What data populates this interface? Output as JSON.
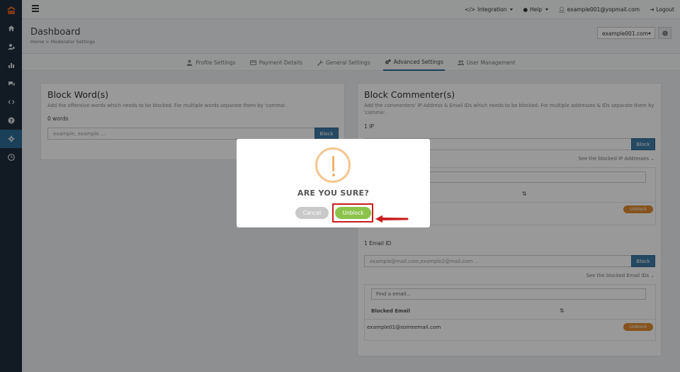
{
  "topbar": {
    "integration": "Integration",
    "help": "Help",
    "user_email": "example001@yopmail.com",
    "logout": "Logout"
  },
  "header": {
    "title": "Dashboard",
    "breadcrumb": "Home  >  Moderator Settings",
    "domain": "example001.com"
  },
  "tabs": [
    {
      "label": "Profile Settings",
      "icon": "user-icon"
    },
    {
      "label": "Payment Details",
      "icon": "card-icon"
    },
    {
      "label": "General Settings",
      "icon": "wrench-icon"
    },
    {
      "label": "Advanced Settings",
      "icon": "gears-icon",
      "active": true
    },
    {
      "label": "User Management",
      "icon": "users-icon"
    }
  ],
  "block_words": {
    "title": "Block Word(s)",
    "description": "Add the offensive words which needs to be blocked. For multiple words separate them by 'comma'.",
    "count": "0 words",
    "placeholder": "example, example ...",
    "button": "Block"
  },
  "block_commenter": {
    "title": "Block Commenter(s)",
    "description_line1": "Add the commenters' IP Address & Email IDs which needs to be blocked. For multiple addresses & IDs separate them by",
    "description_line2": "'comma'.",
    "ip_count": "1 IP",
    "ip_button": "Block",
    "see_ip": "See the blocked IP Addresses",
    "ip_unblock": "Unblock",
    "email_count": "1 Email ID",
    "email_placeholder": "example@mail.com,example2@mail.com ...",
    "email_button": "Block",
    "see_email": "See the blocked Email IDs",
    "find_email_placeholder": "Find a email...",
    "email_column": "Blocked Email",
    "email_row": "example01@someemail.com",
    "email_unblock": "Unblock"
  },
  "modal": {
    "title": "ARE YOU SURE?",
    "cancel": "Cancel",
    "confirm": "Unblock"
  },
  "colors": {
    "sidebar": "#1f2d3d",
    "primary": "#3f7aa6",
    "unblock": "#e08a30",
    "confirm": "#8bc34a",
    "highlight": "#c81e1e"
  }
}
